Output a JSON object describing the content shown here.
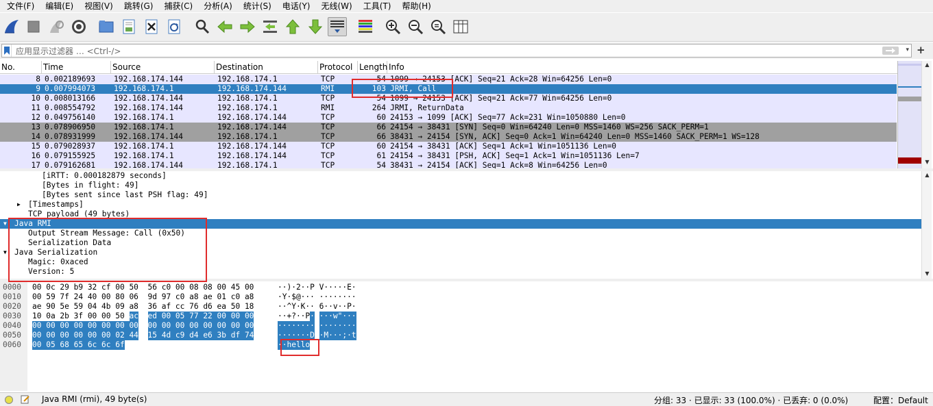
{
  "menu": [
    "文件(F)",
    "编辑(E)",
    "视图(V)",
    "跳转(G)",
    "捕获(C)",
    "分析(A)",
    "统计(S)",
    "电话(Y)",
    "无线(W)",
    "工具(T)",
    "帮助(H)"
  ],
  "toolbar": {
    "icons": [
      "shark-fin-start-icon",
      "stop-capture-icon",
      "restart-capture-icon",
      "capture-options-icon",
      "open-file-icon",
      "save-file-icon",
      "close-file-icon",
      "reload-file-icon",
      "find-packet-icon",
      "go-back-icon",
      "go-forward-icon",
      "go-to-packet-icon",
      "go-first-icon",
      "go-last-icon",
      "autoscroll-icon",
      "colorize-icon",
      "zoom-in-icon",
      "zoom-out-icon",
      "zoom-normal-icon",
      "resize-columns-icon"
    ]
  },
  "filter": {
    "placeholder": "应用显示过滤器 … <Ctrl-/>"
  },
  "packet_list": {
    "columns": [
      "No.",
      "Time",
      "Source",
      "Destination",
      "Protocol",
      "Length",
      "Info"
    ],
    "rows": [
      {
        "no": "8",
        "time": "0.002189693",
        "src": "192.168.174.144",
        "dst": "192.168.174.1",
        "proto": "TCP",
        "len": "54",
        "info": "1099 → 24153 [ACK] Seq=21 Ack=28 Win=64256 Len=0",
        "style": "normal"
      },
      {
        "no": "9",
        "time": "0.007994073",
        "src": "192.168.174.1",
        "dst": "192.168.174.144",
        "proto": "RMI",
        "len": "103",
        "info": "JRMI, Call",
        "style": "selected"
      },
      {
        "no": "10",
        "time": "0.008013166",
        "src": "192.168.174.144",
        "dst": "192.168.174.1",
        "proto": "TCP",
        "len": "54",
        "info": "1099 → 24153 [ACK] Seq=21 Ack=77 Win=64256 Len=0",
        "style": "normal"
      },
      {
        "no": "11",
        "time": "0.008554792",
        "src": "192.168.174.144",
        "dst": "192.168.174.1",
        "proto": "RMI",
        "len": "264",
        "info": "JRMI, ReturnData",
        "style": "normal"
      },
      {
        "no": "12",
        "time": "0.049756140",
        "src": "192.168.174.1",
        "dst": "192.168.174.144",
        "proto": "TCP",
        "len": "60",
        "info": "24153 → 1099 [ACK] Seq=77 Ack=231 Win=1050880 Len=0",
        "style": "normal"
      },
      {
        "no": "13",
        "time": "0.078906950",
        "src": "192.168.174.1",
        "dst": "192.168.174.144",
        "proto": "TCP",
        "len": "66",
        "info": "24154 → 38431 [SYN] Seq=0 Win=64240 Len=0 MSS=1460 WS=256 SACK_PERM=1",
        "style": "gray"
      },
      {
        "no": "14",
        "time": "0.078931999",
        "src": "192.168.174.144",
        "dst": "192.168.174.1",
        "proto": "TCP",
        "len": "66",
        "info": "38431 → 24154 [SYN, ACK] Seq=0 Ack=1 Win=64240 Len=0 MSS=1460 SACK_PERM=1 WS=128",
        "style": "gray"
      },
      {
        "no": "15",
        "time": "0.079028937",
        "src": "192.168.174.1",
        "dst": "192.168.174.144",
        "proto": "TCP",
        "len": "60",
        "info": "24154 → 38431 [ACK] Seq=1 Ack=1 Win=1051136 Len=0",
        "style": "normal"
      },
      {
        "no": "16",
        "time": "0.079155925",
        "src": "192.168.174.1",
        "dst": "192.168.174.144",
        "proto": "TCP",
        "len": "61",
        "info": "24154 → 38431 [PSH, ACK] Seq=1 Ack=1 Win=1051136 Len=7",
        "style": "normal"
      },
      {
        "no": "17",
        "time": "0.079162681",
        "src": "192.168.174.144",
        "dst": "192.168.174.1",
        "proto": "TCP",
        "len": "54",
        "info": "38431 → 24154 [ACK] Seq=1 Ack=8 Win=64256 Len=0",
        "style": "normal"
      }
    ]
  },
  "details": [
    {
      "text": "[iRTT: 0.000182879 seconds]",
      "indent": 3,
      "expander": "none",
      "style": "normal"
    },
    {
      "text": "[Bytes in flight: 49]",
      "indent": 3,
      "expander": "none",
      "style": "normal"
    },
    {
      "text": "[Bytes sent since last PSH flag: 49]",
      "indent": 3,
      "expander": "none",
      "style": "normal"
    },
    {
      "text": "[Timestamps]",
      "indent": 2,
      "expander": "collapsed",
      "style": "normal"
    },
    {
      "text": "TCP payload (49 bytes)",
      "indent": 2,
      "expander": "none",
      "style": "normal"
    },
    {
      "text": "Java RMI",
      "indent": 1,
      "expander": "expanded",
      "style": "selected"
    },
    {
      "text": "Output Stream Message: Call (0x50)",
      "indent": 2,
      "expander": "none",
      "style": "normal"
    },
    {
      "text": "Serialization Data",
      "indent": 2,
      "expander": "none",
      "style": "normal"
    },
    {
      "text": "Java Serialization",
      "indent": 1,
      "expander": "expanded",
      "style": "normal"
    },
    {
      "text": "Magic: 0xaced",
      "indent": 2,
      "expander": "none",
      "style": "normal"
    },
    {
      "text": "Version: 5",
      "indent": 2,
      "expander": "none",
      "style": "normal"
    }
  ],
  "hex": [
    {
      "offset": "0000",
      "a": "00 0c 29 b9 32 cf 00 50",
      "b": "56 c0 00 08 08 00 45 00",
      "asc_a": "··)·2··P",
      "asc_b": "V·····E·",
      "sel": "none"
    },
    {
      "offset": "0010",
      "a": "00 59 7f 24 40 00 80 06",
      "b": "9d 97 c0 a8 ae 01 c0 a8",
      "asc_a": "·Y·$@···",
      "asc_b": "········",
      "sel": "none"
    },
    {
      "offset": "0020",
      "a": "ae 90 5e 59 04 4b 09 a8",
      "b": "36 af cc 76 d6 ea 50 18",
      "asc_a": "··^Y·K··",
      "asc_b": "6··v··P·",
      "sel": "none"
    },
    {
      "offset": "0030",
      "a": "10 0a 2b 3f 00 00 50",
      "a2": "ac",
      "b": "ed 00 05 77 22 00 00 00",
      "asc_a": "··+?··P",
      "asc_a2": "·",
      "asc_b": "···w\"···",
      "sel": "partial"
    },
    {
      "offset": "0040",
      "a": "00 00 00 00 00 00 00 00",
      "b": "00 00 00 00 00 00 00 00",
      "asc_a": "········",
      "asc_b": "········",
      "sel": "full"
    },
    {
      "offset": "0050",
      "a": "00 00 00 00 00 00 02 44",
      "b": "15 4d c9 d4 e6 3b df 74",
      "asc_a": "·······D",
      "asc_b": "·M···;·t",
      "sel": "full"
    },
    {
      "offset": "0060",
      "a": "00 05 68 65 6c 6c 6f",
      "b": "",
      "asc_a": "··hello",
      "asc_b": "",
      "sel": "full"
    }
  ],
  "status": {
    "protocol_info": "Java RMI (rmi), 49 byte(s)",
    "stats": "分组: 33 · 已显示: 33 (100.0%) · 已丢弃: 0 (0.0%)",
    "profile": "配置：Default"
  },
  "colors": {
    "selected": "#2f7fc0",
    "tcp_row": "#e7e6ff",
    "gray_row": "#a0a0a0",
    "annotation": "#e02b2b"
  }
}
